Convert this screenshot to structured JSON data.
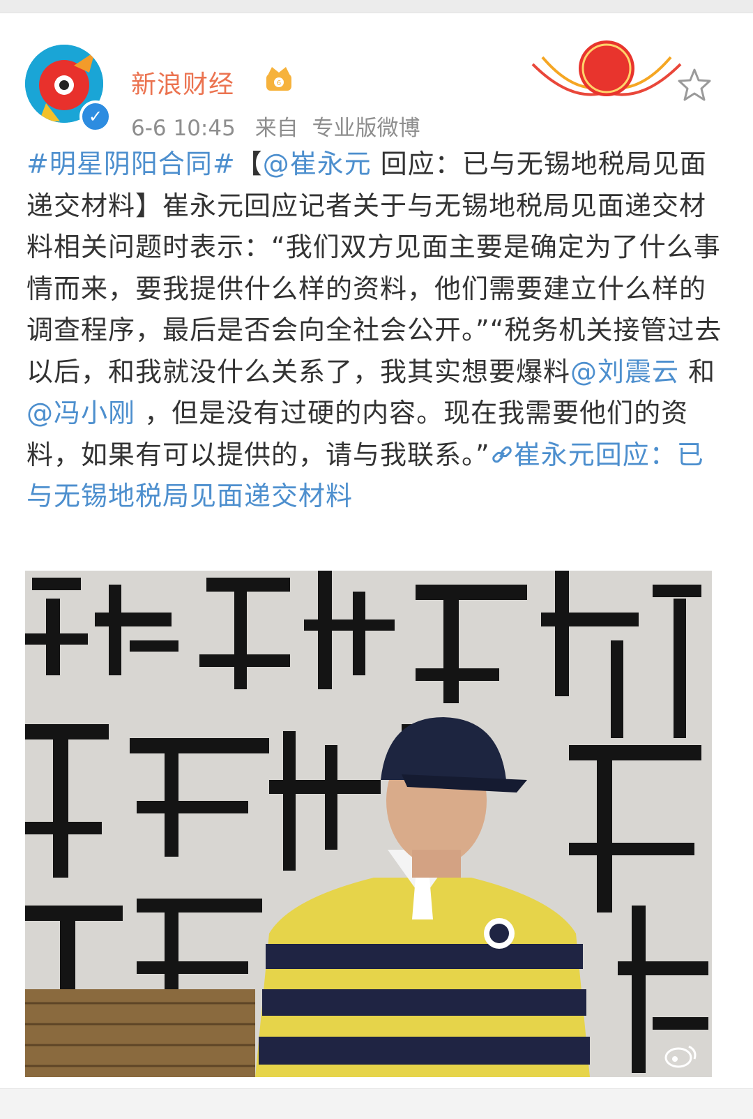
{
  "author": {
    "name": "新浪财经",
    "verified": true,
    "avatar_icon": "sina-eye-logo-icon",
    "level_badge_icon": "crown-badge-icon"
  },
  "meta": {
    "time": "6-6 10:45",
    "source_prefix": "来自",
    "source": "专业版微博"
  },
  "badges": {
    "campaign_icon": "china-zan-badge-icon"
  },
  "post": {
    "hashtag": "#明星阴阳合同#",
    "bracket_open": "【",
    "mention_cui": "@崔永元",
    "title_rest": " 回应：已与无锡地税局见面递交材料",
    "bracket_close": "】",
    "body_1": "崔永元回应记者关于与无锡地税局见面递交材料相关问题时表示：“我们双方见面主要是确定为了什么事情而来，要我提供什么样的资料，他们需要建立什么样的调查程序，最后是否会向全社会公开。”“税务机关接管过去以后，和我就没什么关系了，我其实想要爆料",
    "mention_liu": "@刘震云",
    "body_2": " 和",
    "mention_feng": "@冯小刚",
    "body_3": " ，但是没有过硬的内容。现在我需要他们的资料，如果有可以提供的，请与我联系。”",
    "link_text": "崔永元回应：已与无锡地税局见面递交材料"
  },
  "image": {
    "watermark_icon": "weibo-watermark-icon"
  },
  "colors": {
    "name": "#eb7350",
    "link": "#4d8fce",
    "meta": "#8e8e8e",
    "text": "#333333"
  }
}
